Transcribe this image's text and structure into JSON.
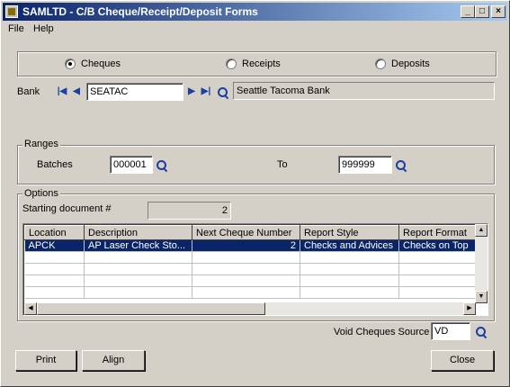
{
  "window": {
    "title": "SAMLTD - C/B Cheque/Receipt/Deposit Forms"
  },
  "menu": [
    {
      "label": "File"
    },
    {
      "label": "Help"
    }
  ],
  "form_type": {
    "options": [
      {
        "label": "Cheques",
        "selected": true
      },
      {
        "label": "Receipts",
        "selected": false
      },
      {
        "label": "Deposits",
        "selected": false
      }
    ]
  },
  "bank": {
    "label": "Bank",
    "code": "SEATAC",
    "name": "Seattle Tacoma Bank"
  },
  "ranges": {
    "legend": "Ranges",
    "batches_label": "Batches",
    "from": "000001",
    "to_label": "To",
    "to": "999999"
  },
  "options": {
    "legend": "Options",
    "start_doc_label": "Starting document #",
    "start_doc_value": "2"
  },
  "grid": {
    "columns": [
      "Location",
      "Description",
      "Next Cheque Number",
      "Report Style",
      "Report Format"
    ],
    "rows": [
      {
        "location": "APCK",
        "description": "AP Laser Check Sto...",
        "next_number": "2",
        "style": "Checks and Advices",
        "format": "Checks on Top",
        "selected": true
      }
    ]
  },
  "void_source": {
    "label": "Void Cheques Source",
    "value": "VD"
  },
  "buttons": {
    "print": "Print",
    "align": "Align",
    "close": "Close"
  },
  "colors": {
    "title_bar": "#0a246a",
    "selection": "#0a246a",
    "face": "#d4d0c8"
  }
}
